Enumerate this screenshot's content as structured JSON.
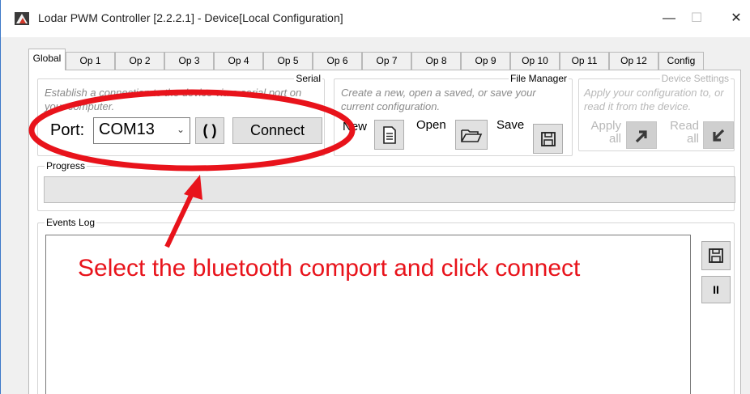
{
  "window": {
    "title": "Lodar PWM Controller [2.2.2.1] - Device[Local Configuration]",
    "minimize_glyph": "—",
    "maximize_glyph": "☐",
    "close_glyph": "✕"
  },
  "tabs": [
    {
      "label": "Global",
      "active": true
    },
    {
      "label": "Op 1"
    },
    {
      "label": "Op 2"
    },
    {
      "label": "Op 3"
    },
    {
      "label": "Op 4"
    },
    {
      "label": "Op 5"
    },
    {
      "label": "Op 6"
    },
    {
      "label": "Op 7"
    },
    {
      "label": "Op 8"
    },
    {
      "label": "Op 9"
    },
    {
      "label": "Op 10"
    },
    {
      "label": "Op 11"
    },
    {
      "label": "Op 12"
    },
    {
      "label": "Config"
    }
  ],
  "serial": {
    "title": "Serial",
    "description": "Establish a connection to the device via a serial port on your computer.",
    "port_label": "Port:",
    "port_value": "COM13",
    "refresh_icon": "refresh-icon",
    "connect_label": "Connect"
  },
  "file_manager": {
    "title": "File Manager",
    "description": "Create a new, open a saved, or save your current configuration.",
    "new_label": "New",
    "open_label": "Open",
    "save_label": "Save"
  },
  "device_settings": {
    "title": "Device Settings",
    "description": "Apply your configuration to, or read it from the device.",
    "apply_line1": "Apply",
    "apply_line2": "all",
    "read_line1": "Read",
    "read_line2": "all"
  },
  "progress": {
    "title": "Progress"
  },
  "events_log": {
    "title": "Events Log",
    "save_icon": "save-icon",
    "pause_label": "II"
  },
  "annotation": {
    "text": "Select the bluetooth comport and click connect",
    "color": "#e8131b"
  }
}
